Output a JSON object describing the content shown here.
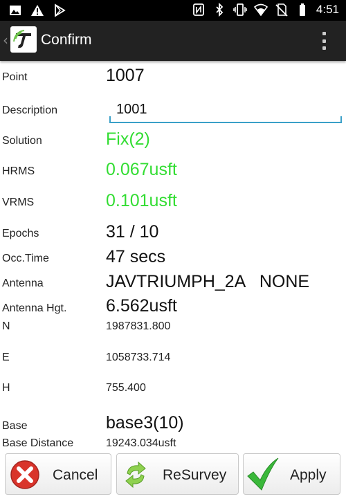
{
  "status_bar": {
    "time": "4:51",
    "icons_left": [
      "image-icon",
      "warning-icon",
      "play-store-icon"
    ],
    "icons_right": [
      "nfc-icon",
      "bluetooth-icon",
      "vibrate-icon",
      "wifi-icon",
      "no-sim-icon",
      "battery-icon"
    ]
  },
  "action_bar": {
    "back_glyph": "‹",
    "title": "Confirm",
    "logo_icon": "app-logo-icon",
    "menu_icon": "overflow-menu-icon"
  },
  "fields": {
    "point": {
      "label": "Point",
      "value": "1007"
    },
    "description": {
      "label": "Description",
      "value": "1001"
    },
    "solution": {
      "label": "Solution",
      "value": "Fix(2)"
    },
    "hrms": {
      "label": "HRMS",
      "value": "0.067usft"
    },
    "vrms": {
      "label": "VRMS",
      "value": "0.101usft"
    },
    "epochs": {
      "label": "Epochs",
      "value": "31 / 10"
    },
    "occ_time": {
      "label": "Occ.Time",
      "value": "47 secs"
    },
    "antenna": {
      "label": "Antenna",
      "value": "JAVTRIUMPH_2A   NONE"
    },
    "antenna_hgt": {
      "label": "Antenna Hgt.",
      "value": "6.562usft"
    },
    "n": {
      "label": "N",
      "value": "1987831.800"
    },
    "e": {
      "label": "E",
      "value": "1058733.714"
    },
    "h": {
      "label": "H",
      "value": "755.400"
    },
    "base": {
      "label": "Base",
      "value": "base3(10)"
    },
    "base_distance": {
      "label": "Base Distance",
      "value": "19243.034usft"
    }
  },
  "buttons": {
    "cancel": {
      "label": "Cancel",
      "icon": "cancel-x-icon"
    },
    "resurvey": {
      "label": "ReSurvey",
      "icon": "refresh-arrows-icon"
    },
    "apply": {
      "label": "Apply",
      "icon": "checkmark-icon"
    }
  },
  "colors": {
    "accent_green": "#33dd33",
    "input_underline": "#3aa0c8",
    "action_bar_bg": "#222222",
    "cancel_red": "#d9342b",
    "apply_green": "#3ab83a"
  }
}
